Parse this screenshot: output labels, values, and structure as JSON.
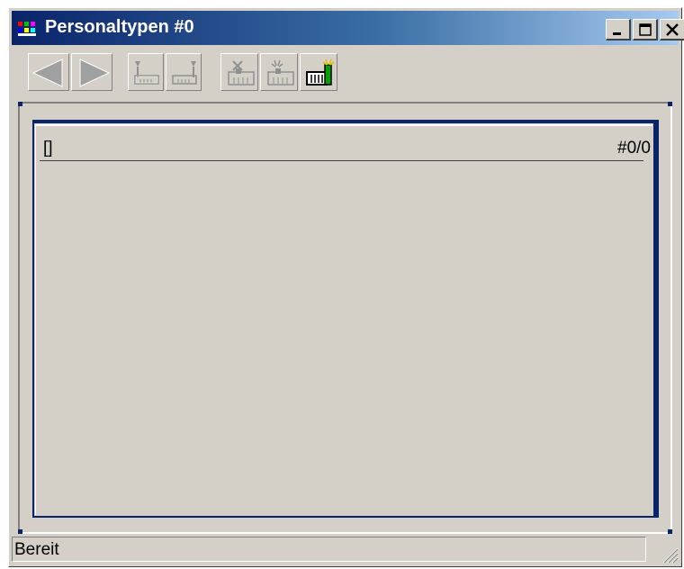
{
  "window": {
    "title": "Personaltypen #0",
    "app_icon": "multicolor-app-icon",
    "controls": [
      "minimize-icon",
      "maximize-icon",
      "close-icon"
    ]
  },
  "toolbar": {
    "buttons": [
      {
        "name": "previous-button",
        "icon": "left-triangle-icon",
        "enabled": false
      },
      {
        "name": "next-button",
        "icon": "right-triangle-icon",
        "enabled": false
      },
      {
        "name": "first-record-button",
        "icon": "tray-insert-left-icon",
        "enabled": false
      },
      {
        "name": "last-record-button",
        "icon": "tray-insert-right-icon",
        "enabled": false
      },
      {
        "name": "delete-record-button",
        "icon": "building-cross-icon",
        "enabled": false
      },
      {
        "name": "copy-record-button",
        "icon": "building-spark-icon",
        "enabled": false
      },
      {
        "name": "new-record-button",
        "icon": "building-new-icon",
        "enabled": true
      }
    ]
  },
  "record": {
    "value": "[]",
    "counter": "#0/0"
  },
  "status": {
    "text": "Bereit"
  },
  "colors": {
    "face": "#d4d0c8",
    "title_start": "#0a246a",
    "title_end": "#a6caf0",
    "panel_border": "#0a246a"
  }
}
